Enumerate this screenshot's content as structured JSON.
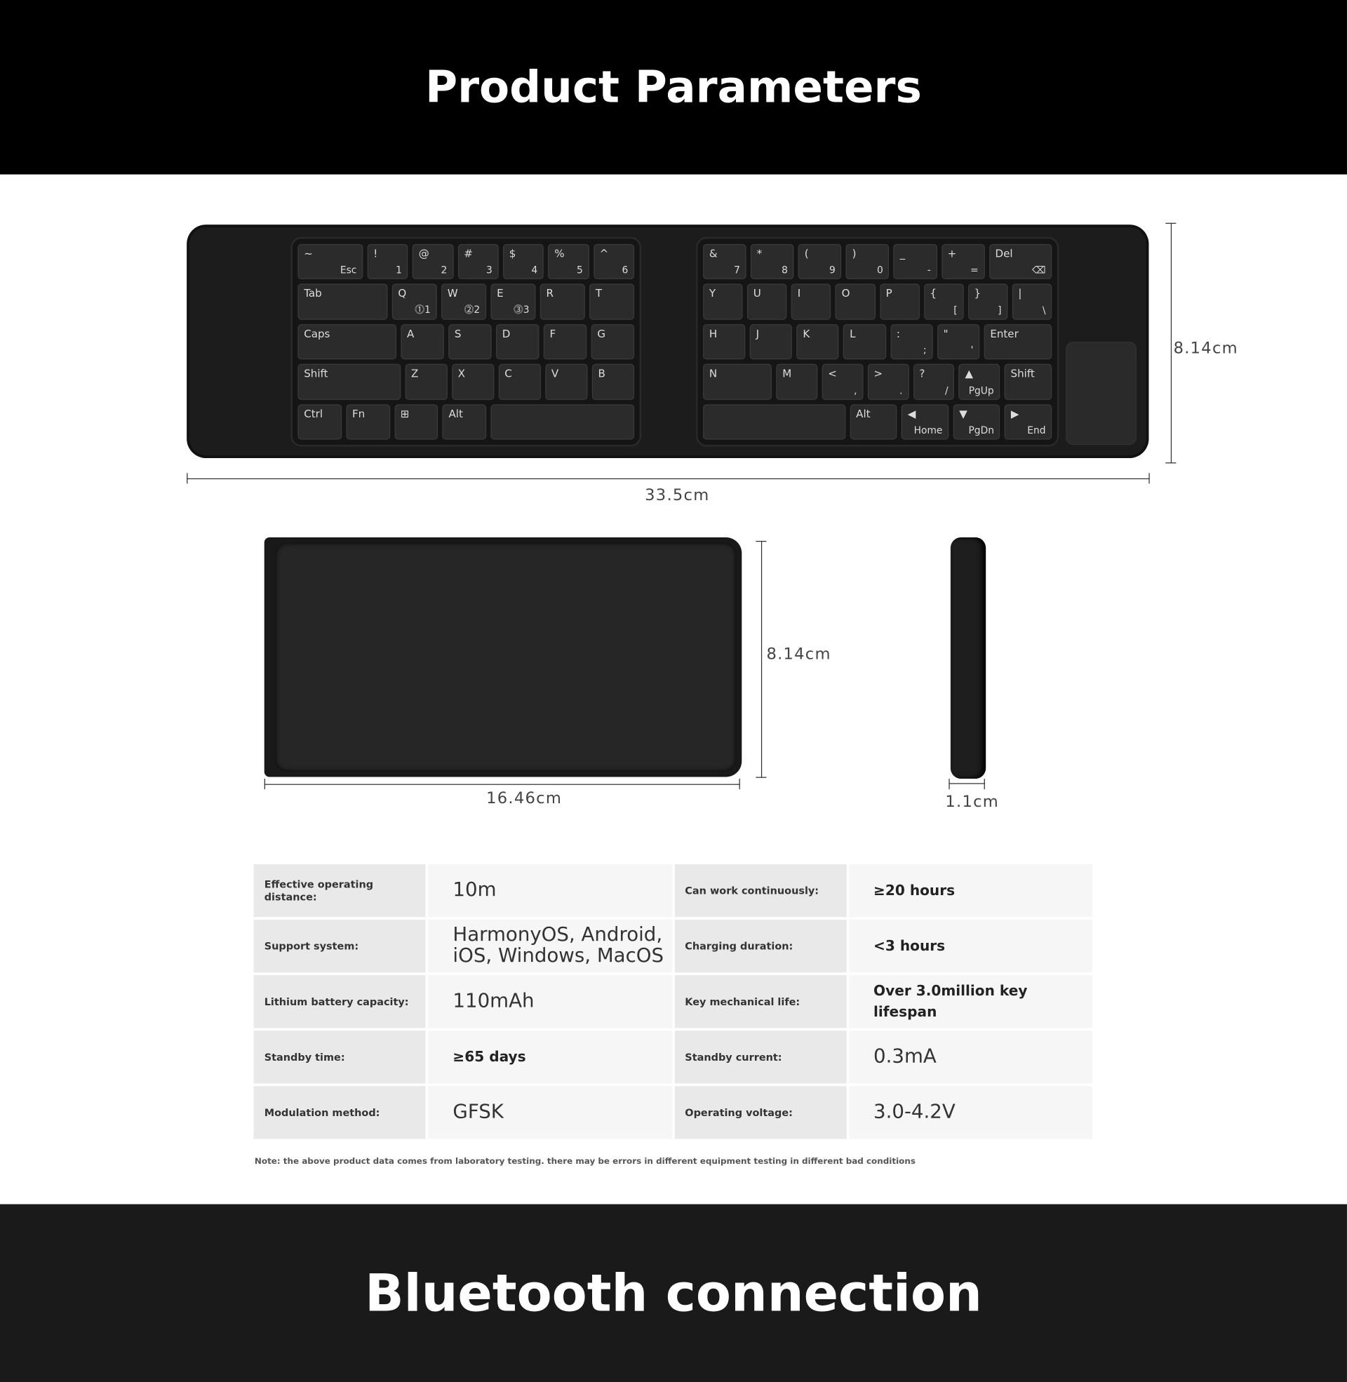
{
  "header": {
    "title": "Product Parameters"
  },
  "footer": {
    "title": "Bluetooth connection"
  },
  "keyboard": {
    "left": [
      [
        [
          "~",
          "Esc"
        ],
        [
          "!",
          "1"
        ],
        [
          "@",
          "2"
        ],
        [
          "#",
          "3"
        ],
        [
          "$",
          "4"
        ],
        [
          "%",
          "5"
        ],
        [
          "^",
          "6"
        ]
      ],
      [
        [
          "Tab",
          ""
        ],
        [
          "Q",
          "⓵1"
        ],
        [
          "W",
          "⓶2"
        ],
        [
          "E",
          "⓷3"
        ],
        [
          "R",
          ""
        ],
        [
          "T",
          ""
        ]
      ],
      [
        [
          "Caps",
          ""
        ],
        [
          "A",
          ""
        ],
        [
          "S",
          ""
        ],
        [
          "D",
          ""
        ],
        [
          "F",
          ""
        ],
        [
          "G",
          ""
        ]
      ],
      [
        [
          "Shift",
          ""
        ],
        [
          "Z",
          ""
        ],
        [
          "X",
          ""
        ],
        [
          "C",
          ""
        ],
        [
          "V",
          ""
        ],
        [
          "B",
          ""
        ]
      ],
      [
        [
          "Ctrl",
          ""
        ],
        [
          "Fn",
          ""
        ],
        [
          "⊞",
          ""
        ],
        [
          "Alt",
          ""
        ],
        [
          "",
          ""
        ]
      ]
    ],
    "right": [
      [
        [
          "&",
          "7"
        ],
        [
          "*",
          "8"
        ],
        [
          "(",
          "9"
        ],
        [
          ")",
          "0"
        ],
        [
          "_",
          "-"
        ],
        [
          "+",
          "="
        ],
        [
          "Del",
          "⌫"
        ]
      ],
      [
        [
          "Y",
          ""
        ],
        [
          "U",
          ""
        ],
        [
          "I",
          ""
        ],
        [
          "O",
          ""
        ],
        [
          "P",
          ""
        ],
        [
          "{",
          "["
        ],
        [
          "}",
          "]"
        ],
        [
          "|",
          "\\"
        ]
      ],
      [
        [
          "H",
          ""
        ],
        [
          "J",
          ""
        ],
        [
          "K",
          ""
        ],
        [
          "L",
          ""
        ],
        [
          ":",
          ";"
        ],
        [
          "\"",
          "'"
        ],
        [
          "Enter",
          ""
        ]
      ],
      [
        [
          "N",
          ""
        ],
        [
          "M",
          ""
        ],
        [
          "<",
          ","
        ],
        [
          ">",
          "."
        ],
        [
          "?",
          "/"
        ],
        [
          "▲",
          "PgUp"
        ],
        [
          "Shift",
          ""
        ]
      ],
      [
        [
          "",
          ""
        ],
        [
          "Alt",
          ""
        ],
        [
          "◀",
          "Home"
        ],
        [
          "▼",
          "PgDn"
        ],
        [
          "▶",
          "End"
        ]
      ]
    ]
  },
  "dimensions": {
    "unfolded_width": "33.5cm",
    "unfolded_height": "8.14cm",
    "folded_width": "16.46cm",
    "folded_height": "8.14cm",
    "thickness": "1.1cm"
  },
  "specs": [
    {
      "l1": "Effective operating distance:",
      "v1": "10m",
      "l2": "Can work continuously:",
      "v2": "≥20 hours"
    },
    {
      "l1": "Support system:",
      "v1": "HarmonyOS, Android, iOS, Windows, MacOS",
      "l2": "Charging duration:",
      "v2": "<3 hours"
    },
    {
      "l1": "Lithium battery capacity:",
      "v1": "110mAh",
      "l2": "Key mechanical life:",
      "v2": "Over 3.0million key lifespan"
    },
    {
      "l1": "Standby time:",
      "v1": "≥65 days",
      "l2": "Standby current:",
      "v2": "0.3mA"
    },
    {
      "l1": "Modulation method:",
      "v1": "GFSK",
      "l2": "Operating voltage:",
      "v2": "3.0-4.2V"
    }
  ],
  "note": "Note: the above product data comes from laboratory testing. there may be errors in different equipment testing in different bad conditions"
}
